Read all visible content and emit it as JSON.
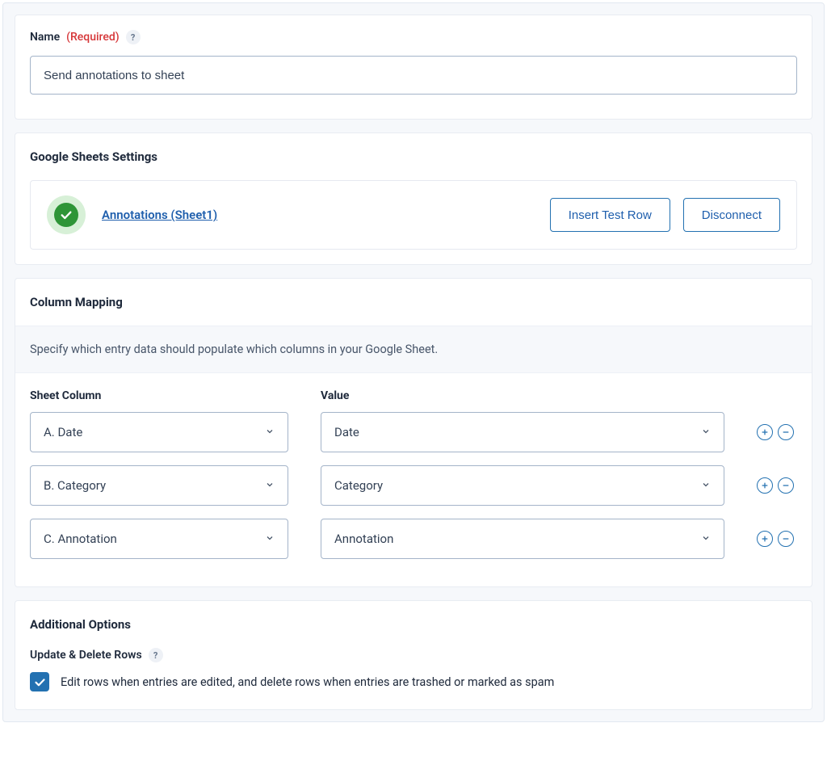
{
  "name_card": {
    "label": "Name",
    "required": "(Required)",
    "value": "Send annotations to sheet"
  },
  "sheets": {
    "title": "Google Sheets Settings",
    "link": "Annotations (Sheet1)",
    "btn_test": "Insert Test Row",
    "btn_disconnect": "Disconnect"
  },
  "mapping": {
    "title": "Column Mapping",
    "desc": "Specify which entry data should populate which columns in your Google Sheet.",
    "head_col": "Sheet Column",
    "head_val": "Value",
    "rows": [
      {
        "col": "A. Date",
        "val": "Date"
      },
      {
        "col": "B. Category",
        "val": "Category"
      },
      {
        "col": "C. Annotation",
        "val": "Annotation"
      }
    ]
  },
  "options": {
    "title": "Additional Options",
    "sub": "Update & Delete Rows",
    "check_label": "Edit rows when entries are edited, and delete rows when entries are trashed or marked as spam"
  },
  "glyphs": {
    "help": "?"
  }
}
